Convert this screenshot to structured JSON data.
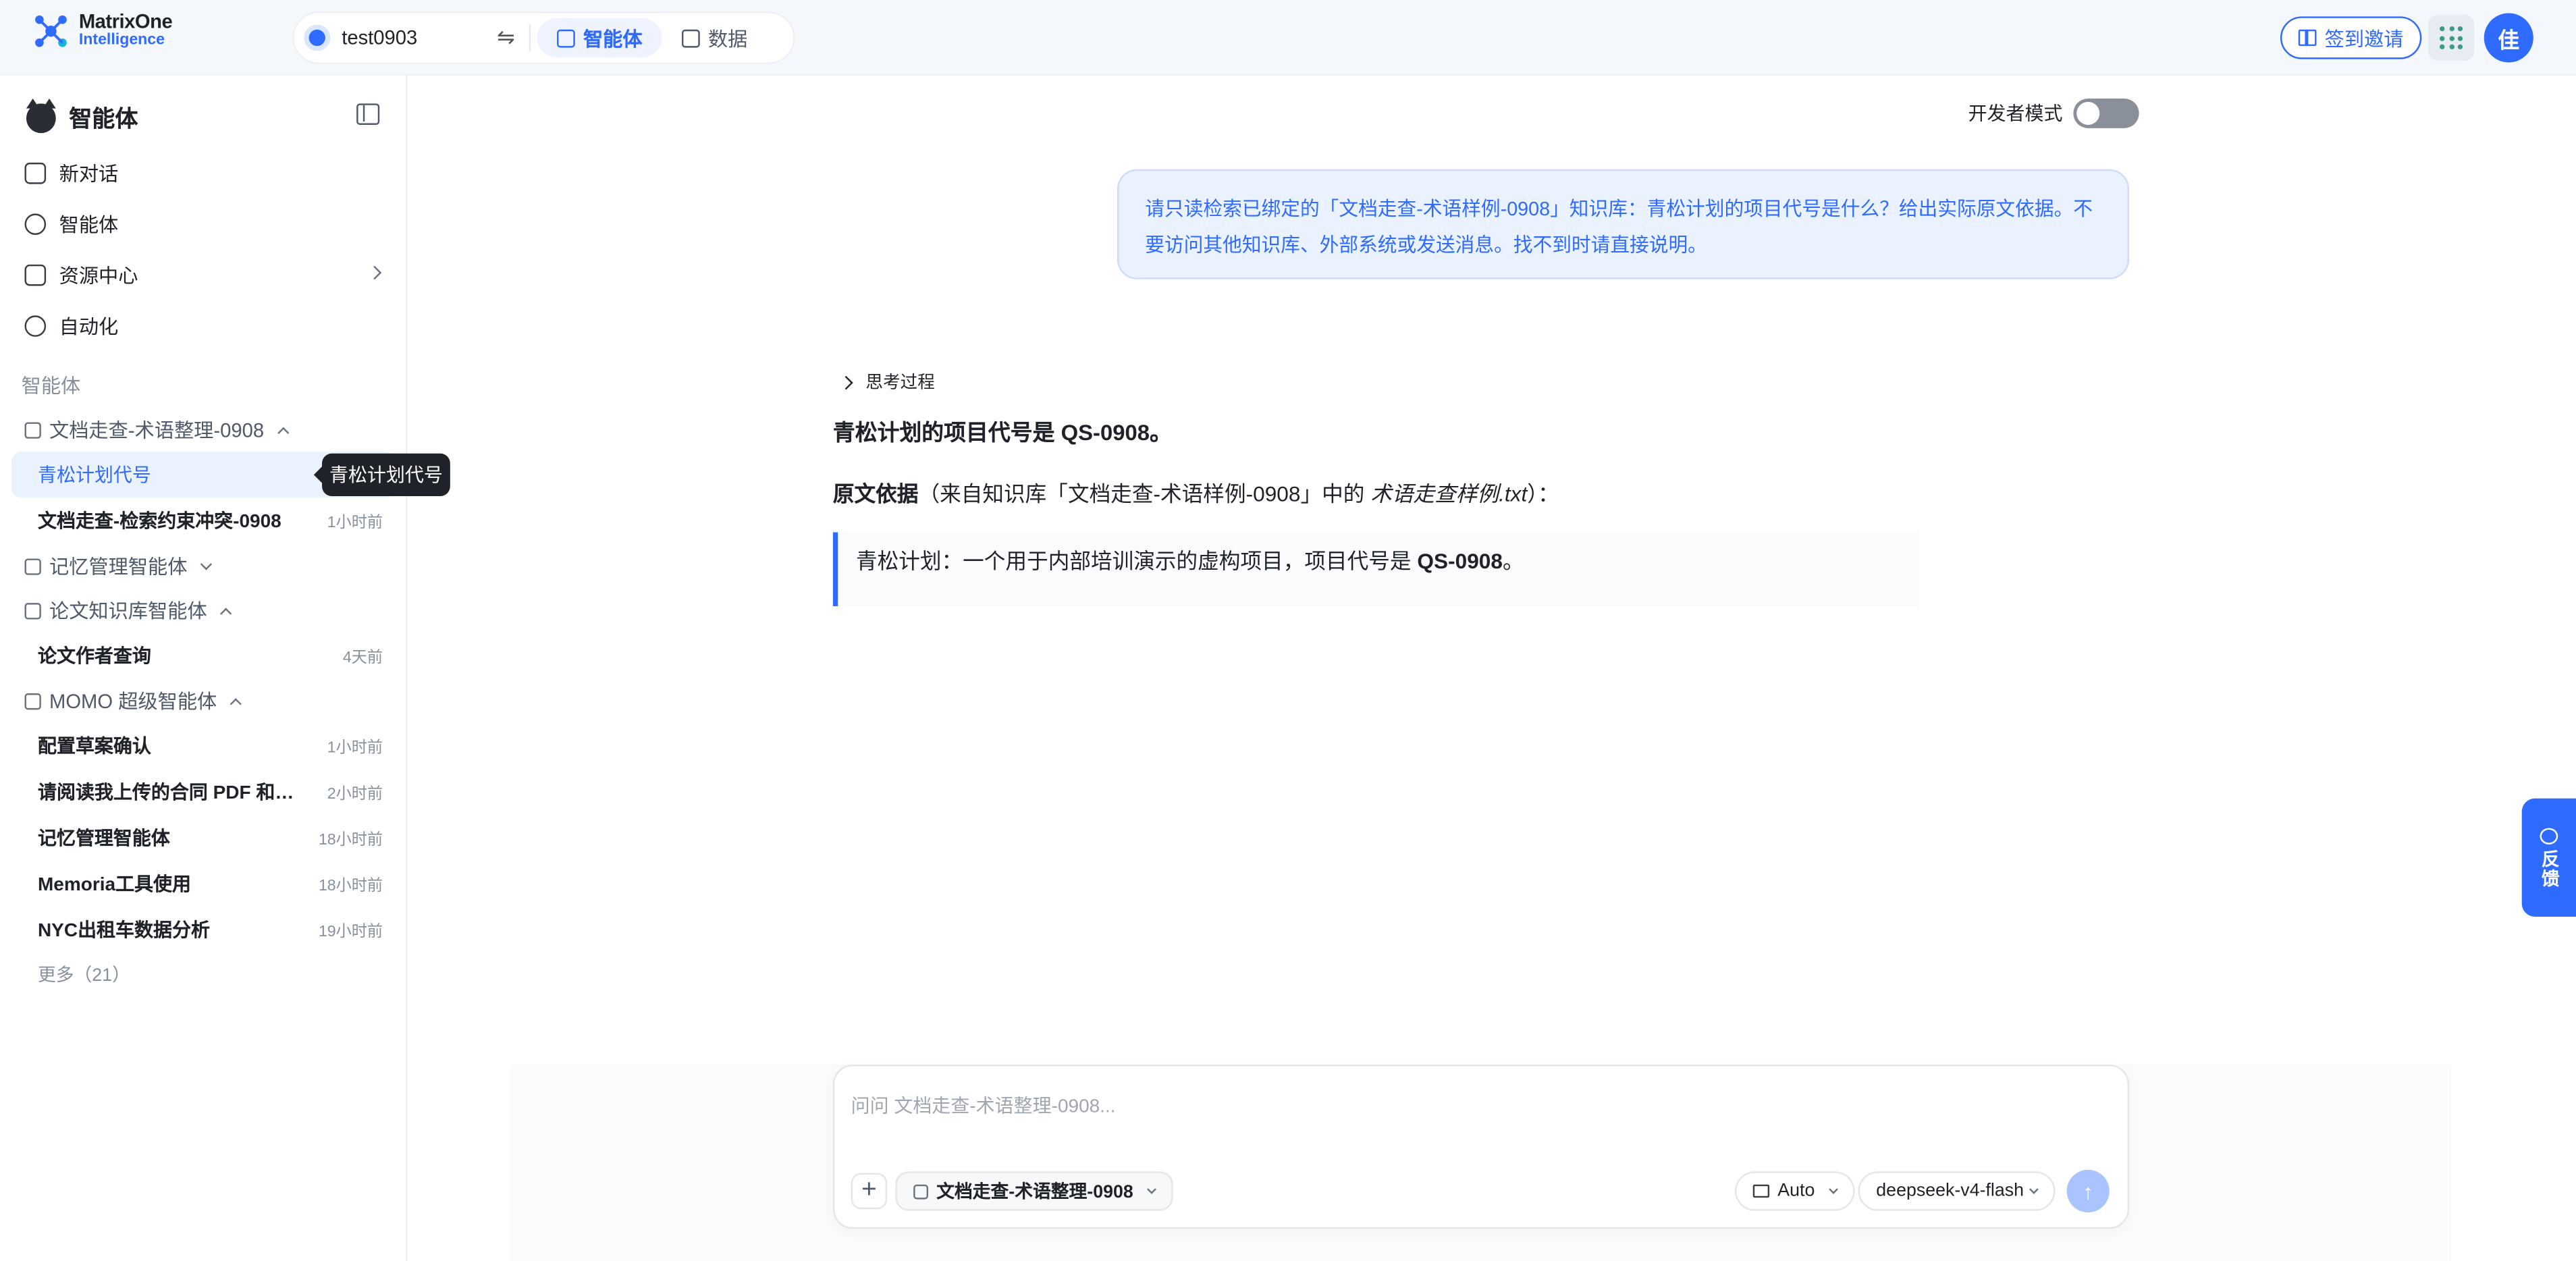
{
  "brand": {
    "line1": "MatrixOne",
    "line2": "Intelligence"
  },
  "header": {
    "workspace": "test0903",
    "tabs": [
      {
        "label": "智能体"
      },
      {
        "label": "数据"
      }
    ],
    "invite_label": "签到邀请",
    "avatar_text": "佳"
  },
  "sidebar": {
    "title": "智能体",
    "menu": [
      {
        "label": "新对话"
      },
      {
        "label": "智能体"
      },
      {
        "label": "资源中心"
      },
      {
        "label": "自动化"
      }
    ],
    "section_label": "智能体",
    "groups": [
      {
        "name": "文档走查-术语整理-0908",
        "conversations": [
          {
            "title": "青松计划代号",
            "time": ""
          },
          {
            "title": "文档走查-检索约束冲突-0908",
            "time": "1小时前"
          }
        ]
      },
      {
        "name": "记忆管理智能体",
        "conversations": []
      },
      {
        "name": "论文知识库智能体",
        "conversations": [
          {
            "title": "论文作者查询",
            "time": "4天前"
          }
        ]
      },
      {
        "name": "MOMO 超级智能体",
        "conversations": [
          {
            "title": "配置草案确认",
            "time": "1小时前"
          },
          {
            "title": "请阅读我上传的合同 PDF 和审...",
            "time": "2小时前"
          },
          {
            "title": "记忆管理智能体",
            "time": "18小时前"
          },
          {
            "title": "Memoria工具使用",
            "time": "18小时前"
          },
          {
            "title": "NYC出租车数据分析",
            "time": "19小时前"
          }
        ]
      }
    ],
    "more_label": "更多（21）"
  },
  "tooltip": "青松计划代号",
  "main": {
    "dev_mode_label": "开发者模式",
    "dev_mode_on": false,
    "user_message": "请只读检索已绑定的「文档走查-术语样例-0908」知识库：青松计划的项目代号是什么？给出实际原文依据。不要访问其他知识库、外部系统或发送消息。找不到时请直接说明。",
    "thinking_label": "思考过程",
    "answer_headline": "青松计划的项目代号是 QS-0908。",
    "source_label": "原文依据",
    "source_prefix": "（来自知识库「文档走查-术语样例-0908」中的 ",
    "source_file": "术语走查样例.txt",
    "source_suffix": "）：",
    "quote_text": "青松计划：一个用于内部培训演示的虚构项目，项目代号是 ",
    "quote_code": "QS-0908",
    "quote_end": "。"
  },
  "composer": {
    "placeholder": "问问 文档走查-术语整理-0908...",
    "kb_chip": "文档走查-术语整理-0908",
    "mode": "Auto",
    "model": "deepseek-v4-flash",
    "send_icon": "↑",
    "plus_icon": "+"
  },
  "feedback_label": "反馈",
  "colors": {
    "accent": "#2f6bff",
    "accent_light": "#eaf1ff"
  }
}
